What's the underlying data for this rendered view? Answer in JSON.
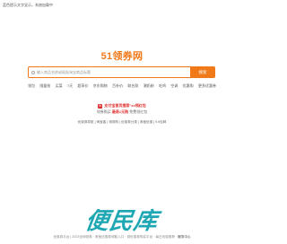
{
  "notice": "蓝色提示文字显示，系统加载中",
  "logo": "51领券网",
  "search": {
    "placeholder": "输入商品名称或粘贴淘宝商品标题",
    "button": "搜索"
  },
  "categories": [
    "领包",
    "限量抢",
    "买菜",
    "7天",
    "超享价",
    "京东购物",
    "百补价",
    "联名款",
    "潮奶粉",
    "吃鸡",
    "空调",
    "优惠购",
    "更多优惠券"
  ],
  "promo": {
    "line1_tag": "tb",
    "line1": "支付宝首页搜索\"xx领红包",
    "line2_pre": "领券购买",
    "line2_highlight": "最高1元购",
    "line2_post": "免费领红包"
  },
  "links": "优惠券导航 | 淘宝客 | 领券购 | 优惠券分类 | 淘宝优惠 | 9.9包邮",
  "brand": "便民库",
  "footer": {
    "text": "优惠券平台 | 2023全网领券 · 淘宝优惠券领取入口 · 领优惠券购买平台 · 每日优惠推荐 · ",
    "highlight": "服务中心"
  },
  "colors": {
    "accent": "#f07a1a",
    "promo_red": "#e03030",
    "brand_teal": "#1fa8b4"
  }
}
